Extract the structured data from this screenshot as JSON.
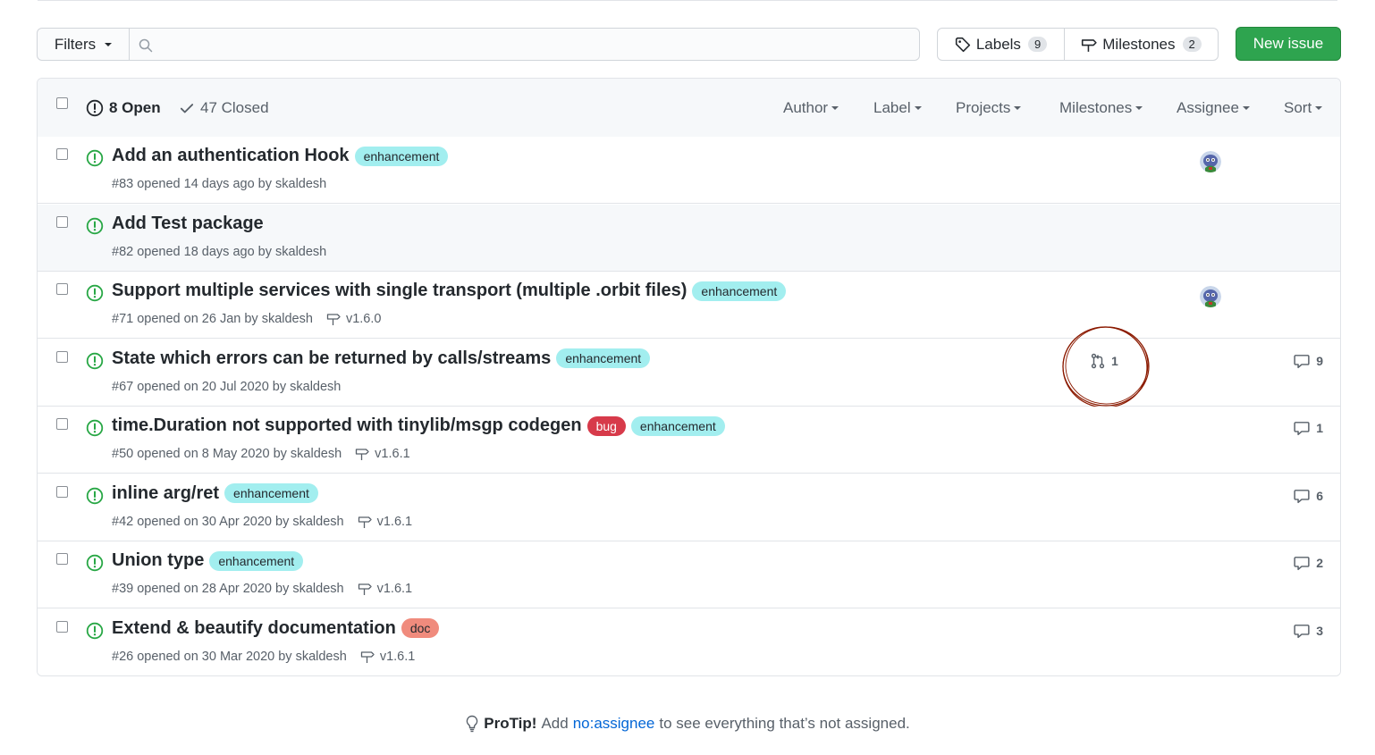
{
  "toolbar": {
    "filters_label": "Filters",
    "search_value": "",
    "labels_label": "Labels",
    "labels_count": "9",
    "milestones_label": "Milestones",
    "milestones_count": "2",
    "new_issue_label": "New issue"
  },
  "header": {
    "open_label": "8 Open",
    "closed_label": "47 Closed",
    "filters": [
      "Author",
      "Label",
      "Projects",
      "Milestones",
      "Assignee",
      "Sort"
    ]
  },
  "issues": [
    {
      "title": "Add an authentication Hook",
      "labels": [
        "enhancement"
      ],
      "meta": "#83 opened 14 days ago by skaldesh",
      "milestone": "",
      "assignee": true,
      "pr": "",
      "comments": ""
    },
    {
      "title": "Add Test package",
      "labels": [],
      "meta": "#82 opened 18 days ago by skaldesh",
      "milestone": "",
      "assignee": false,
      "pr": "",
      "comments": ""
    },
    {
      "title": "Support multiple services with single transport (multiple .orbit files)",
      "labels": [
        "enhancement"
      ],
      "meta": "#71 opened on 26 Jan by skaldesh",
      "milestone": "v1.6.0",
      "assignee": true,
      "pr": "",
      "comments": ""
    },
    {
      "title": "State which errors can be returned by calls/streams",
      "labels": [
        "enhancement"
      ],
      "meta": "#67 opened on 20 Jul 2020 by skaldesh",
      "milestone": "",
      "assignee": false,
      "pr": "1",
      "comments": "9"
    },
    {
      "title": "time.Duration not supported with tinylib/msgp codegen",
      "labels": [
        "bug",
        "enhancement"
      ],
      "meta": "#50 opened on 8 May 2020 by skaldesh",
      "milestone": "v1.6.1",
      "assignee": false,
      "pr": "",
      "comments": "1"
    },
    {
      "title": "inline arg/ret",
      "labels": [
        "enhancement"
      ],
      "meta": "#42 opened on 30 Apr 2020 by skaldesh",
      "milestone": "v1.6.1",
      "assignee": false,
      "pr": "",
      "comments": "6"
    },
    {
      "title": "Union type",
      "labels": [
        "enhancement"
      ],
      "meta": "#39 opened on 28 Apr 2020 by skaldesh",
      "milestone": "v1.6.1",
      "assignee": false,
      "pr": "",
      "comments": "2"
    },
    {
      "title": "Extend & beautify documentation",
      "labels": [
        "doc"
      ],
      "meta": "#26 opened on 30 Mar 2020 by skaldesh",
      "milestone": "v1.6.1",
      "assignee": false,
      "pr": "",
      "comments": "3"
    }
  ],
  "protip": {
    "prefix": "ProTip!",
    "text_before": "Add",
    "link": "no:assignee",
    "text_after": "to see everything that’s not assigned."
  },
  "colors": {
    "accent_green": "#2ea44f",
    "open_icon": "#28a745",
    "link": "#0366d6",
    "annotation_circle": "#8b1a00"
  }
}
